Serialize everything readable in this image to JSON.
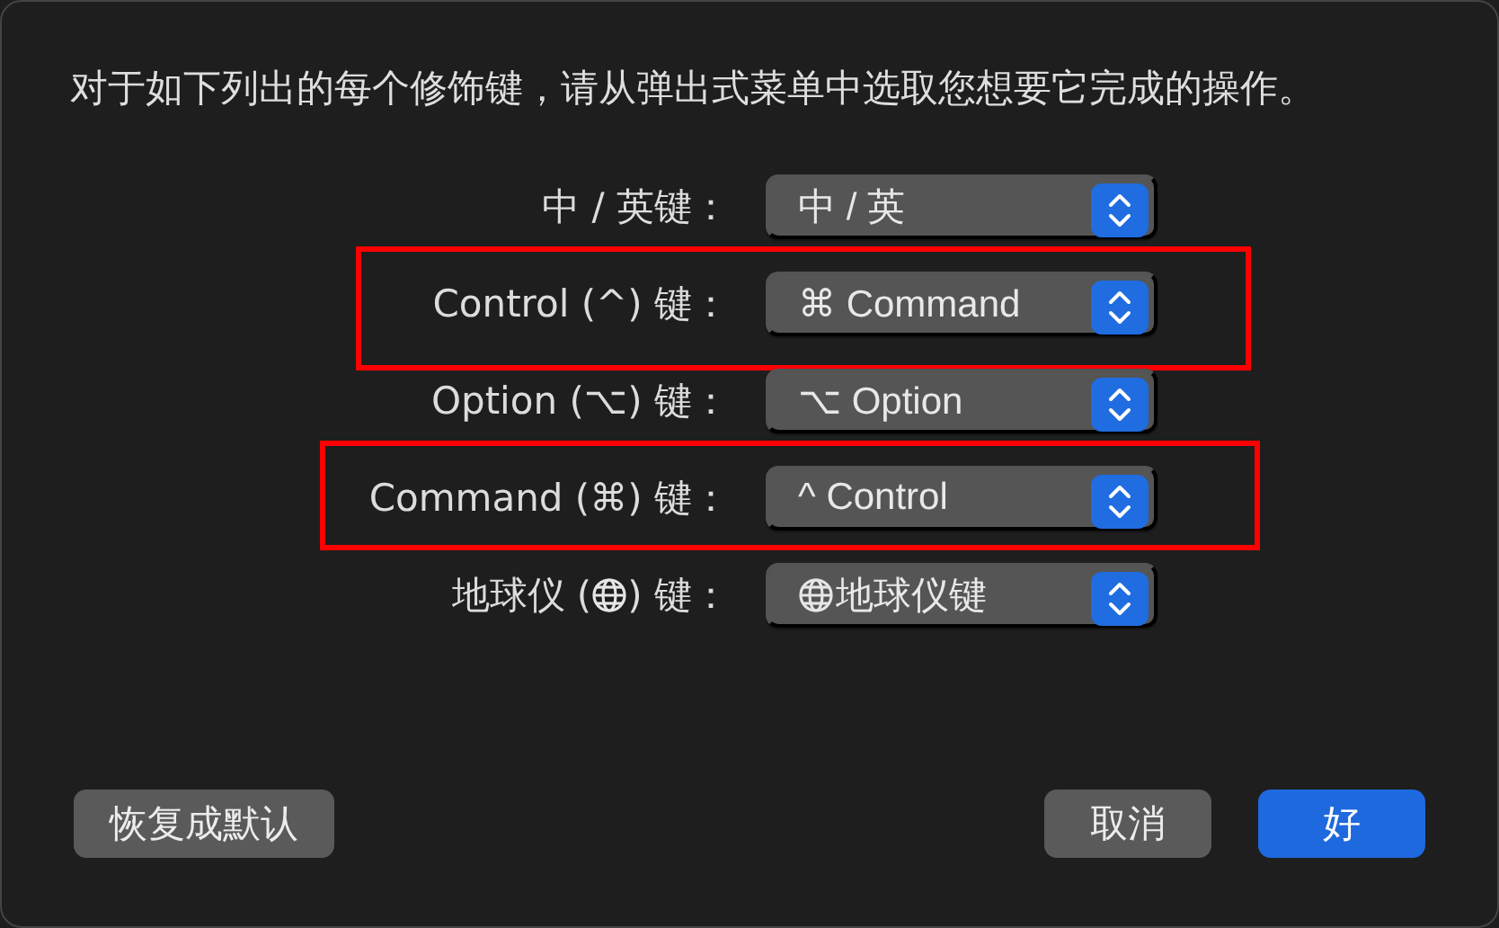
{
  "message": "对于如下列出的每个修饰键，请从弹出式菜单中选取您想要它完成的操作。",
  "rows": [
    {
      "kind": "text",
      "label": "中 / 英键：",
      "value": "中 / 英",
      "highlighted": false
    },
    {
      "kind": "text",
      "label": "Control (^) 键：",
      "value": "⌘ Command",
      "highlighted": true
    },
    {
      "kind": "text",
      "label": "Option (⌥) 键：",
      "value": "⌥ Option",
      "highlighted": false
    },
    {
      "kind": "text",
      "label": "Command (⌘) 键：",
      "value": "^ Control",
      "highlighted": true
    },
    {
      "kind": "globe",
      "label": "地球仪 (",
      "label_end": ") 键：",
      "value": "地球仪键",
      "highlighted": false
    }
  ],
  "buttons": [
    {
      "label": "恢复成默认",
      "kind": "secondary"
    },
    {
      "label": "取消",
      "kind": "secondary"
    },
    {
      "label": "好",
      "kind": "primary"
    }
  ]
}
